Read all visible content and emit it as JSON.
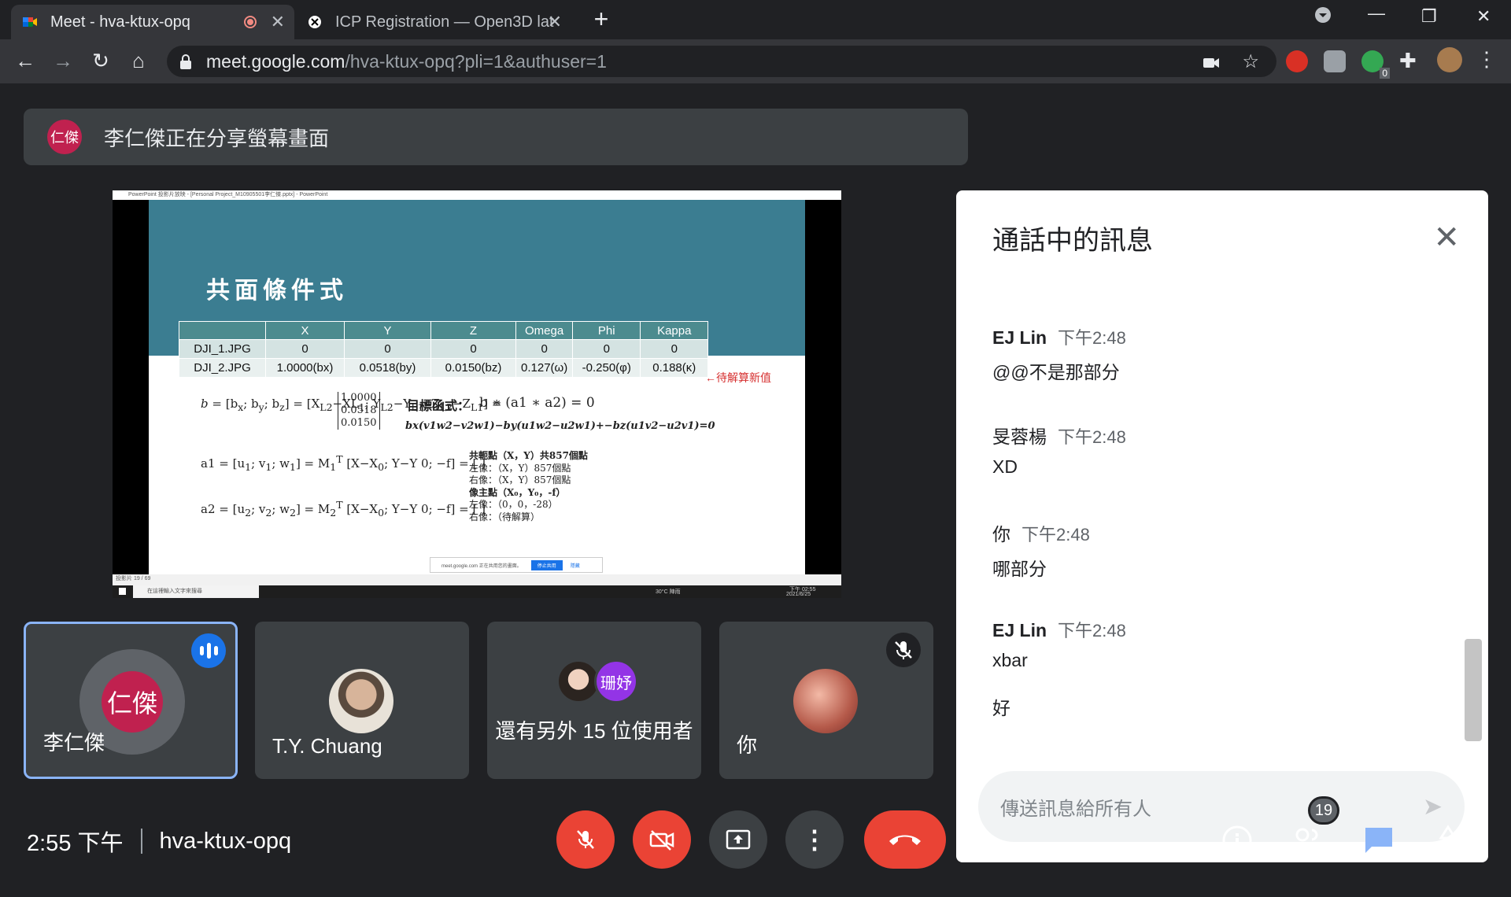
{
  "tabs": [
    {
      "title": "Meet - hva-ktux-opq",
      "active": true
    },
    {
      "title": "ICP Registration — Open3D lat",
      "active": false
    }
  ],
  "url": {
    "host": "meet.google.com",
    "path": "/hva-ktux-opq?pli=1&authuser=1"
  },
  "extensions": {
    "badge": "0"
  },
  "presentation": {
    "banner_text": "李仁傑正在分享螢幕畫面",
    "presenter_initials": "仁傑",
    "ppt_window_title": "PowerPoint 投影片放映 - [Personal Project_M10905501李仁傑.pptx] - PowerPoint",
    "slide_title": "共面條件式",
    "table": {
      "headers": [
        "",
        "X",
        "Y",
        "Z",
        "Omega",
        "Phi",
        "Kappa"
      ],
      "rows": [
        [
          "DJI_1.JPG",
          "0",
          "0",
          "0",
          "0",
          "0",
          "0"
        ],
        [
          "DJI_2.JPG",
          "1.0000(bx)",
          "0.0518(by)",
          "0.0150(bz)",
          "0.127(ω)",
          "-0.250(φ)",
          "0.188(κ)"
        ]
      ]
    },
    "table_note": "←待解算新值",
    "b_vector": [
      "1.0000",
      "0.0518",
      "0.0150"
    ],
    "objective_label": "目標函式：",
    "equation": "bx(v1w2−v2w1)−by(u1w2−u2w1)+−bz(u1v2−u2v1)=0",
    "notes": [
      "共軛點（X，Y）共857個點",
      "左像：（X，Y）857個點",
      "右像：（X，Y）857個點",
      "像主點（X₀，Y₀，-f）",
      "左像：（0，0，-28）",
      "右像：（待解算）"
    ],
    "stop_share_text": "meet.google.com 正在共用您的畫面。",
    "stop_share_button": "停止共用",
    "hide_button": "隱藏",
    "slide_counter": "投影片 19 / 69",
    "taskbar_search": "在這裡輸入文字來搜尋",
    "taskbar_weather": "30°C 陣雨",
    "taskbar_time": "下午 02:55",
    "taskbar_date": "2021/6/25"
  },
  "participants": [
    {
      "name": "李仁傑",
      "initials": "仁傑",
      "speaking": true
    },
    {
      "name": "T.Y. Chuang"
    },
    {
      "name": "還有另外 15 位使用者",
      "badge": "珊妤"
    },
    {
      "name": "你",
      "muted": true
    }
  ],
  "chat": {
    "title": "通話中的訊息",
    "messages": [
      {
        "sender": "EJ Lin",
        "time": "下午2:48",
        "text": "@@不是那部分"
      },
      {
        "sender": "旻蓉楊",
        "time": "下午2:48",
        "text": "XD"
      },
      {
        "sender": "你",
        "time": "下午2:48",
        "text": "哪部分"
      },
      {
        "sender": "EJ Lin",
        "time": "下午2:48",
        "text": "xbar",
        "extra": "好"
      }
    ],
    "input_placeholder": "傳送訊息給所有人"
  },
  "bottom": {
    "time": "2:55 下午",
    "meeting_code": "hva-ktux-opq",
    "people_count": "19"
  },
  "colors": {
    "accent": "#1a73e8",
    "danger": "#ea4335",
    "presenter_avatar": "#c0214f",
    "slide_header": "#3b7d91"
  }
}
